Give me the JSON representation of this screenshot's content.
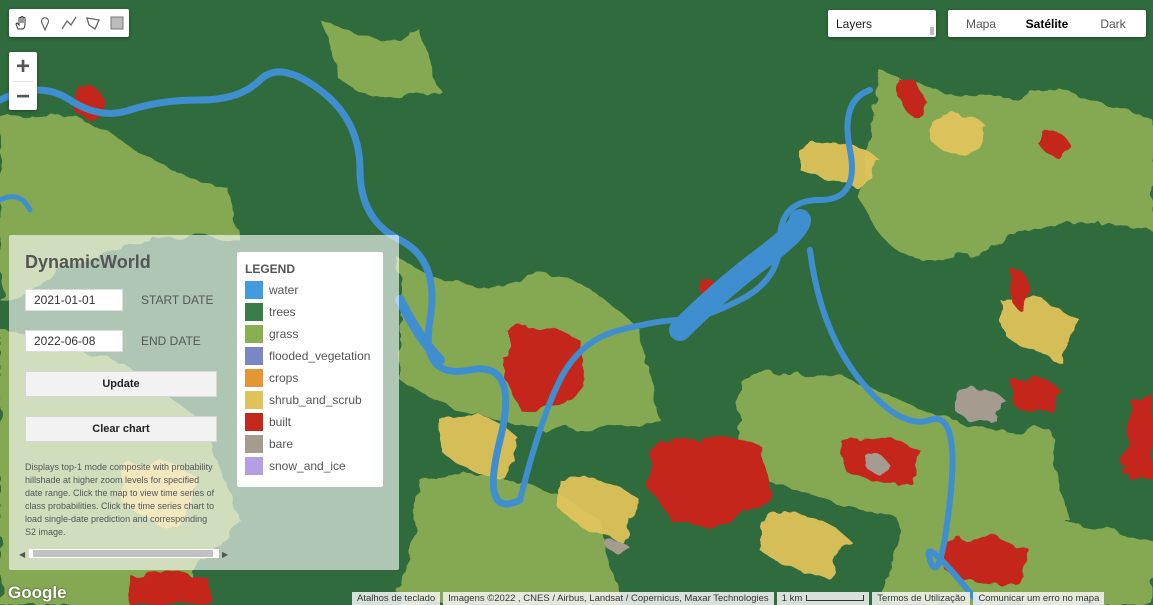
{
  "colors": {
    "water": "#419bdf",
    "trees": "#397d49",
    "grass": "#88b053",
    "flooded_vegetation": "#7a87c6",
    "crops": "#e49635",
    "shrub_and_scrub": "#dfc35a",
    "built": "#c4281b",
    "bare": "#a59b8f",
    "snow_and_ice": "#b39fe1"
  },
  "toolbar": {
    "icons": [
      "hand-icon",
      "point-icon",
      "line-icon",
      "polygon-icon",
      "rectangle-icon"
    ]
  },
  "zoom": {
    "in_label": "+",
    "out_label": "−"
  },
  "layers": {
    "label": "Layers"
  },
  "map_type": {
    "options": [
      "Mapa",
      "Satélite",
      "Dark"
    ],
    "selected": "Satélite"
  },
  "panel": {
    "title": "DynamicWorld",
    "start_date": "2021-01-01",
    "start_label": "START DATE",
    "end_date": "2022-06-08",
    "end_label": "END DATE",
    "update_label": "Update",
    "clear_label": "Clear chart",
    "description": "Displays top-1 mode composite with probability hillshade at higher zoom levels for specified date range. Click the map to view time series of class probabilities. Click the time series chart to load single-date prediction and corresponding S2 image."
  },
  "legend": {
    "title": "LEGEND",
    "items": [
      {
        "label": "water",
        "color": "#419bdf"
      },
      {
        "label": "trees",
        "color": "#397d49"
      },
      {
        "label": "grass",
        "color": "#88b053"
      },
      {
        "label": "flooded_vegetation",
        "color": "#7a87c6"
      },
      {
        "label": "crops",
        "color": "#e49635"
      },
      {
        "label": "shrub_and_scrub",
        "color": "#dfc35a"
      },
      {
        "label": "built",
        "color": "#c4281b"
      },
      {
        "label": "bare",
        "color": "#a59b8f"
      },
      {
        "label": "snow_and_ice",
        "color": "#b39fe1"
      }
    ]
  },
  "footer": {
    "logo": "Google",
    "shortcuts": "Atalhos de teclado",
    "attribution": "Imagens ©2022 , CNES / Airbus, Landsat / Copernicus, Maxar Technologies",
    "scale": "1 km",
    "terms": "Termos de Utilização",
    "report": "Comunicar um erro no mapa"
  }
}
